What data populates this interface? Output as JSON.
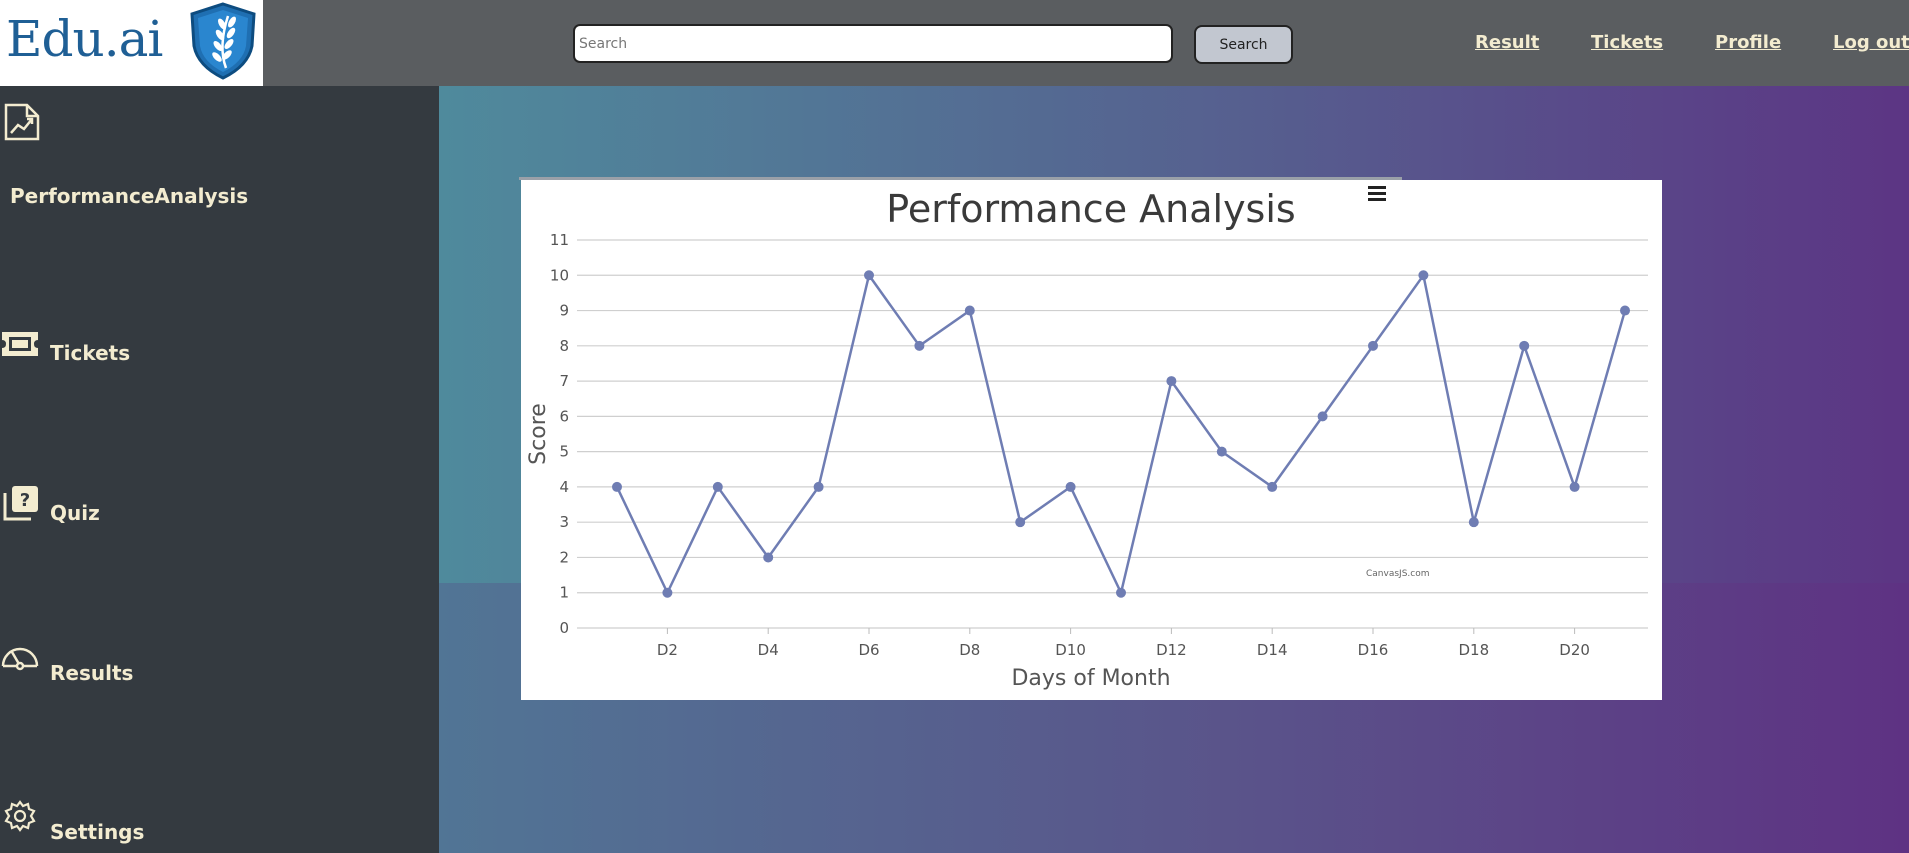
{
  "brand": {
    "name": "Edu.ai"
  },
  "search": {
    "placeholder": "Search",
    "button_label": "Search"
  },
  "nav": {
    "result": "Result",
    "tickets": "Tickets",
    "profile": "Profile",
    "logout": "Log out"
  },
  "sidebar": {
    "items": [
      {
        "label": "PerformanceAnalysis",
        "icon": "chart-icon"
      },
      {
        "label": "Tickets",
        "icon": "ticket-icon"
      },
      {
        "label": "Quiz",
        "icon": "quiz-icon"
      },
      {
        "label": "Results",
        "icon": "gauge-icon"
      },
      {
        "label": "Settings",
        "icon": "gear-icon"
      }
    ]
  },
  "chart_data": {
    "type": "line",
    "title": "Performance Analysis",
    "xlabel": "Days of Month",
    "ylabel": "Score",
    "ylim": [
      0,
      11
    ],
    "x": [
      "D1",
      "D2",
      "D3",
      "D4",
      "D5",
      "D6",
      "D7",
      "D8",
      "D9",
      "D10",
      "D11",
      "D12",
      "D13",
      "D14",
      "D15",
      "D16",
      "D17",
      "D18",
      "D19",
      "D20",
      "D21"
    ],
    "x_tick_labels": [
      "D2",
      "D4",
      "D6",
      "D8",
      "D10",
      "D12",
      "D14",
      "D16",
      "D18",
      "D20"
    ],
    "y_ticks": [
      0,
      1,
      2,
      3,
      4,
      5,
      6,
      7,
      8,
      9,
      10,
      11
    ],
    "series": [
      {
        "values": [
          4,
          1,
          4,
          2,
          4,
          10,
          8,
          9,
          3,
          4,
          1,
          7,
          5,
          4,
          6,
          8,
          10,
          3,
          8,
          4,
          9
        ]
      }
    ],
    "grid": true,
    "color": "#6f7db3",
    "watermark": "CanvasJS.com"
  },
  "colors": {
    "header": "#5a5d60",
    "sidebar": "#343a40",
    "sidebar_text": "#f3ecd0",
    "brand_blue": "#1f5f95"
  }
}
